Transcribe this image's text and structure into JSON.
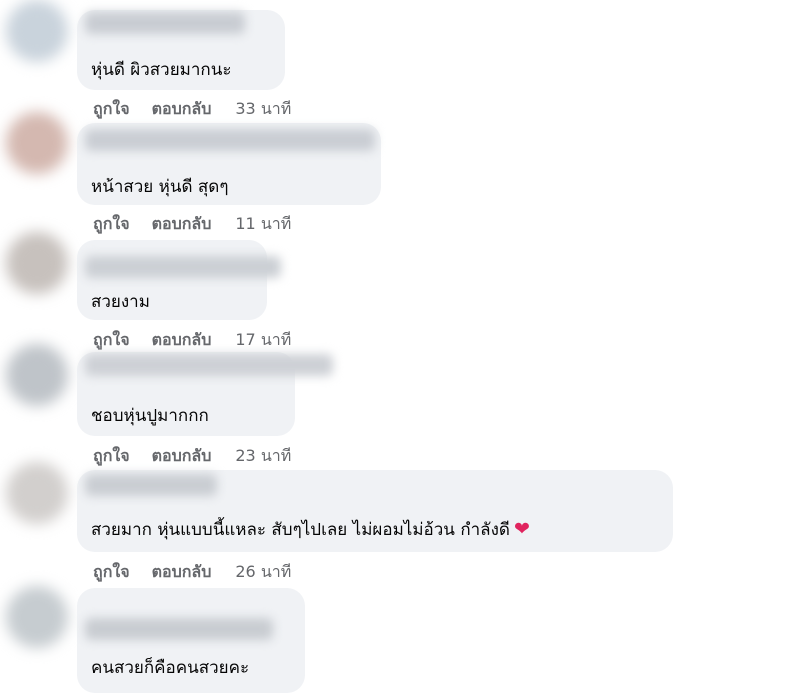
{
  "comments": [
    {
      "text": "หุ่นดี ผิวสวยมากนะ",
      "like": "ถูกใจ",
      "reply": "ตอบกลับ",
      "time": "33 นาที"
    },
    {
      "text": "หน้าสวย หุ่นดี สุดๆ",
      "like": "ถูกใจ",
      "reply": "ตอบกลับ",
      "time": "11 นาที"
    },
    {
      "text": "สวยงาม",
      "like": "ถูกใจ",
      "reply": "ตอบกลับ",
      "time": "17 นาที"
    },
    {
      "text": "ชอบหุ่นปูมากกก",
      "like": "ถูกใจ",
      "reply": "ตอบกลับ",
      "time": "23 นาที"
    },
    {
      "text": "สวยมาก หุ่นแบบนี้แหละ สับๆไปเลย ไม่ผอมไม่อ้วน กำลังดี",
      "like": "ถูกใจ",
      "reply": "ตอบกลับ",
      "time": "26 นาที",
      "emoji": "heart-icon"
    },
    {
      "text": "คนสวยก็คือคนสวยคะ"
    }
  ],
  "colors": {
    "bubble": "#f0f2f5",
    "meta_text": "#65676b",
    "heart": "#e0245e"
  }
}
